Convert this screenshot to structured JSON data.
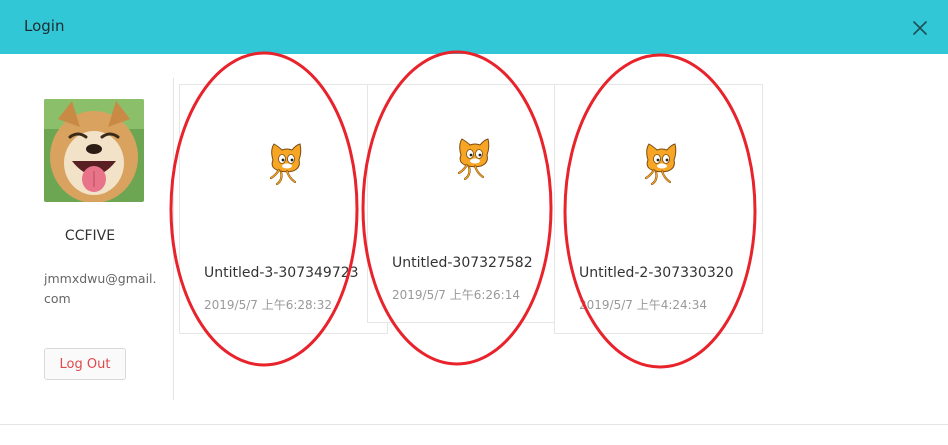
{
  "dialog": {
    "title": "Login",
    "close_icon": "close-icon"
  },
  "user": {
    "name": "CCFIVE",
    "email": "jmmxdwu@gmail.com",
    "logout_label": "Log Out",
    "avatar_icon": "dog-avatar"
  },
  "projects": [
    {
      "name": "Untitled-3-307349723",
      "date": "2019/5/7 上午6:28:32",
      "thumbnail": "scratch-cat-icon"
    },
    {
      "name": "Untitled-307327582",
      "date": "2019/5/7 上午6:26:14",
      "thumbnail": "scratch-cat-icon"
    },
    {
      "name": "Untitled-2-307330320",
      "date": "2019/5/7 上午4:24:34",
      "thumbnail": "scratch-cat-icon"
    }
  ],
  "annotation": {
    "color": "#e8232b",
    "shape": "ellipse-outline"
  },
  "colors": {
    "header": "#31c7d6",
    "logout_text": "#e0484b"
  }
}
